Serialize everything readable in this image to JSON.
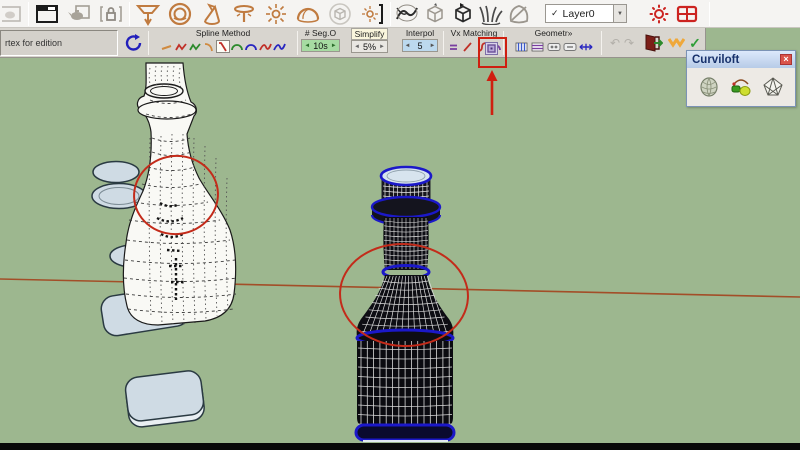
{
  "colors": {
    "viewport_bg": "#9db78f",
    "annotation_red": "#c32b1a",
    "axis_line": "#a34e28",
    "ring_blue": "#1b18c9",
    "toolbar_bg": "#f5f4f2",
    "parambar_bg": "#d8d5cf",
    "seg_spinner_bg": "#a6dba2",
    "interpol_spinner_bg": "#bcd9ee",
    "panel_title_from": "#dce9fb",
    "panel_title_to": "#b7cbe7"
  },
  "toolbar": {
    "layer_check": "✓",
    "layer_value": "Layer0",
    "layer_scroll_glyph": "▼"
  },
  "param_bar": {
    "status_text": "rtex for edition",
    "spline_method_label": "Spline Method",
    "seg_label": "# Seg.O",
    "seg_value": "10s",
    "simplify_label": "Simplify",
    "simplify_value": "5%",
    "interpol_label": "Interpol",
    "interpol_value": "5",
    "vx_label": "Vx Matching",
    "geometry_label": "Geometr»",
    "spin_left": "◄",
    "spin_right": "►",
    "undo_glyph": "↶",
    "redo_glyph": "↷",
    "confirm_glyph": "✓"
  },
  "curviloft_panel": {
    "title": "Curviloft",
    "close_glyph": "×"
  }
}
